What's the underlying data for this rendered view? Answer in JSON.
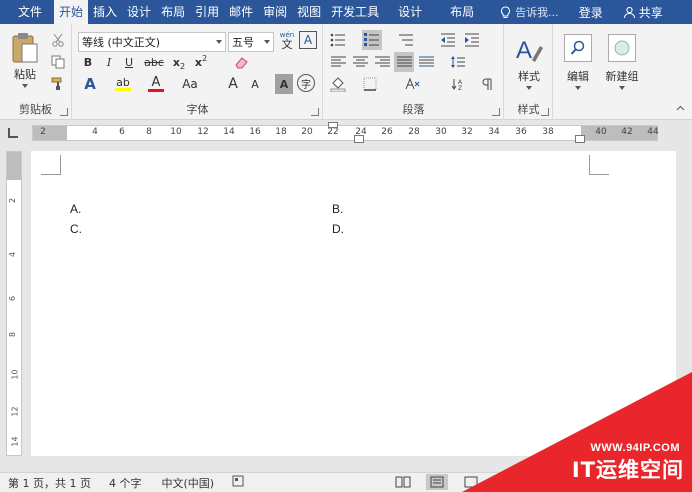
{
  "tabs": {
    "file": "文件",
    "home": "开始",
    "insert": "插入",
    "design": "设计",
    "layout": "布局",
    "references": "引用",
    "mailings": "邮件",
    "review": "审阅",
    "view": "视图",
    "developer": "开发工具",
    "ctx_design": "设计",
    "ctx_layout": "布局",
    "tell_me": "告诉我...",
    "login": "登录",
    "share": "共享"
  },
  "clipboard": {
    "paste": "粘贴",
    "label": "剪贴板"
  },
  "font": {
    "name": "等线 (中文正文)",
    "size": "五号",
    "wen": "wén",
    "wen_char": "文",
    "A_char": "A",
    "bold": "B",
    "italic": "I",
    "underline": "U",
    "strike": "abc",
    "sub": "x",
    "sub2": "2",
    "sup": "x",
    "sup2": "2",
    "text_effect": "A",
    "highlight": "ab",
    "font_color": "A",
    "change_case": "Aa",
    "grow": "A",
    "shrink": "A",
    "shade": "A",
    "enclose": "字",
    "label": "字体"
  },
  "paragraph": {
    "label": "段落"
  },
  "styles": {
    "label_btn": "样式",
    "label": "样式"
  },
  "editing": {
    "label": "编辑"
  },
  "newgroup": {
    "label": "新建组"
  },
  "ruler": {
    "ticks": [
      "2",
      "2",
      "4",
      "6",
      "8",
      "10",
      "12",
      "14",
      "16",
      "18",
      "20",
      "22",
      "24",
      "26",
      "28",
      "30",
      "32",
      "34",
      "36",
      "38",
      "40",
      "42",
      "44"
    ],
    "vticks": [
      "2",
      "4",
      "6",
      "8",
      "10",
      "12",
      "14"
    ]
  },
  "document": {
    "a": "A.",
    "b": "B.",
    "c": "C.",
    "d": "D."
  },
  "status": {
    "page": "第 1 页，共 1 页",
    "words": "4 个字",
    "lang": "中文(中国)"
  },
  "watermark": {
    "url": "WWW.94IP.COM",
    "name": "IT运维空间"
  },
  "colors": {
    "accent": "#2b579a",
    "highlight": "#ffff00",
    "font_red": "#e81123",
    "watermark": "#e8262b"
  }
}
